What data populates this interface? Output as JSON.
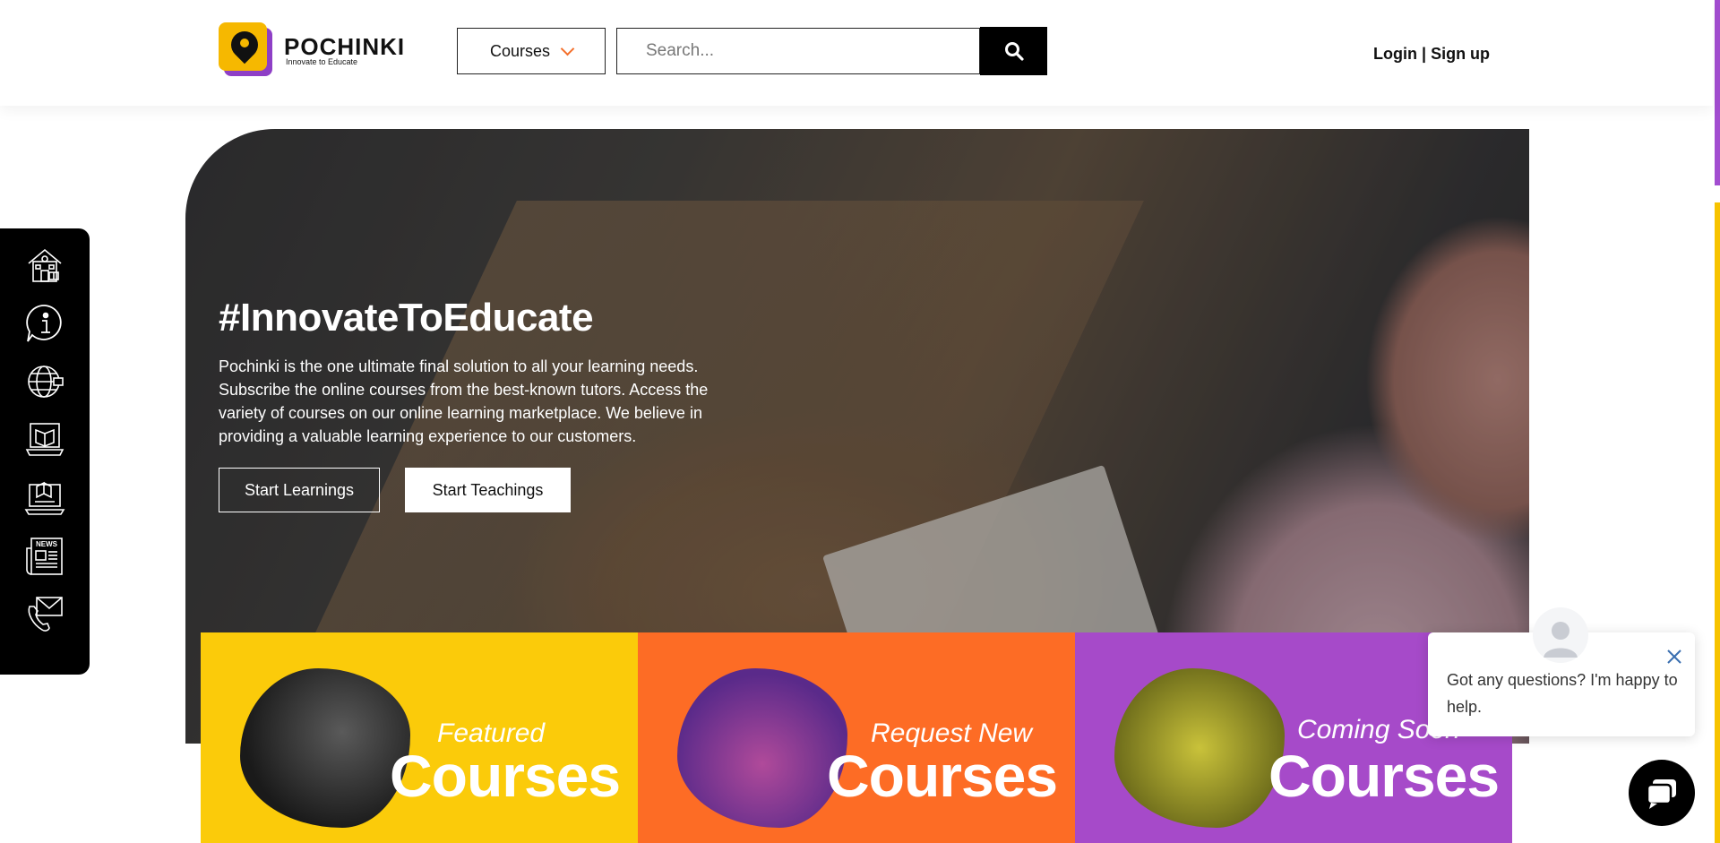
{
  "brand": {
    "name": "POCHINKI",
    "tagline": "Innovate to Educate",
    "colors": {
      "yellow": "#f6b800",
      "purple": "#8e3fc6",
      "orange": "#f46f2a",
      "black": "#000000"
    }
  },
  "header": {
    "courses_dropdown": {
      "label": "Courses",
      "icon": "chevron-down-icon"
    },
    "search": {
      "placeholder": "Search...",
      "value": "",
      "button_icon": "search-icon"
    },
    "auth": {
      "login": "Login",
      "separator": "|",
      "signup": "Sign up"
    }
  },
  "sidebar": {
    "items": [
      {
        "icon": "school-icon"
      },
      {
        "icon": "info-icon"
      },
      {
        "icon": "globe-icon"
      },
      {
        "icon": "online-course-icon"
      },
      {
        "icon": "laptop-book-icon"
      },
      {
        "icon": "news-icon",
        "label": "NEWS"
      },
      {
        "icon": "contact-mail-icon"
      }
    ]
  },
  "hero": {
    "title": "#InnovateToEducate",
    "description": "Pochinki is the one ultimate final solution to all your learning needs. Subscribe the online courses from the best-known tutors. Access the variety of courses on our online learning marketplace. We believe in providing a valuable learning experience to our customers.",
    "primary_button": "Start Learnings",
    "secondary_button": "Start Teachings"
  },
  "cards": [
    {
      "small": "Featured",
      "big": "Courses",
      "color": "#fbcb0a"
    },
    {
      "small": "Request New",
      "big": "Courses",
      "color": "#fd6c25"
    },
    {
      "small": "Coming Soon",
      "big": "Courses",
      "color": "#a64ac9"
    }
  ],
  "chat": {
    "message": "Got any questions? I'm happy to help.",
    "close_icon": "close-icon",
    "launcher_icon": "chat-icon"
  }
}
